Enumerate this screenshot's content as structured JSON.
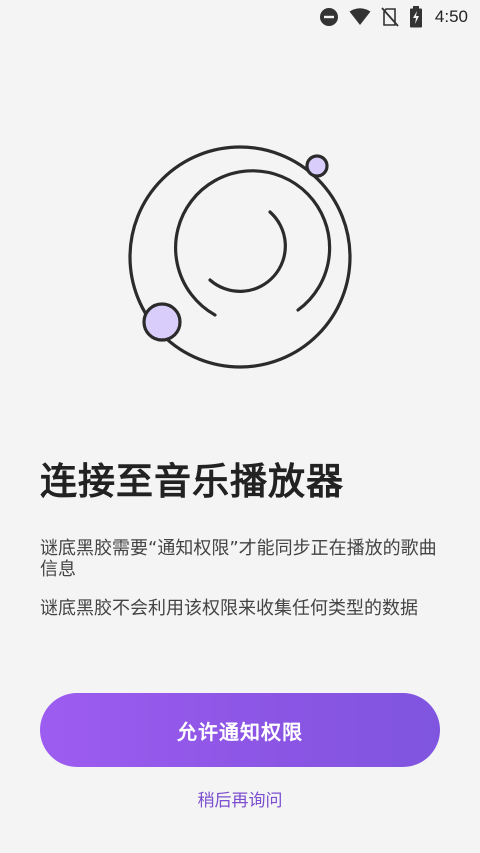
{
  "status_bar": {
    "time": "4:50",
    "icons": [
      "do-not-disturb-icon",
      "wifi-icon",
      "no-sim-icon",
      "battery-charging-icon"
    ]
  },
  "onboarding": {
    "title": "连接至音乐播放器",
    "paragraph1": "谜底黑胶需要“通知权限”才能同步正在播放的歌曲信息",
    "paragraph2": "谜底黑胶不会利用该权限来收集任何类型的数据",
    "allow_button_label": "允许通知权限",
    "later_link_label": "稍后再询问"
  },
  "colors": {
    "background": "#f4f4f4",
    "accent": "#8b55e4",
    "accent_light": "#d8cdfb",
    "link": "#7b4fd0",
    "outline": "#2b2b2b"
  }
}
